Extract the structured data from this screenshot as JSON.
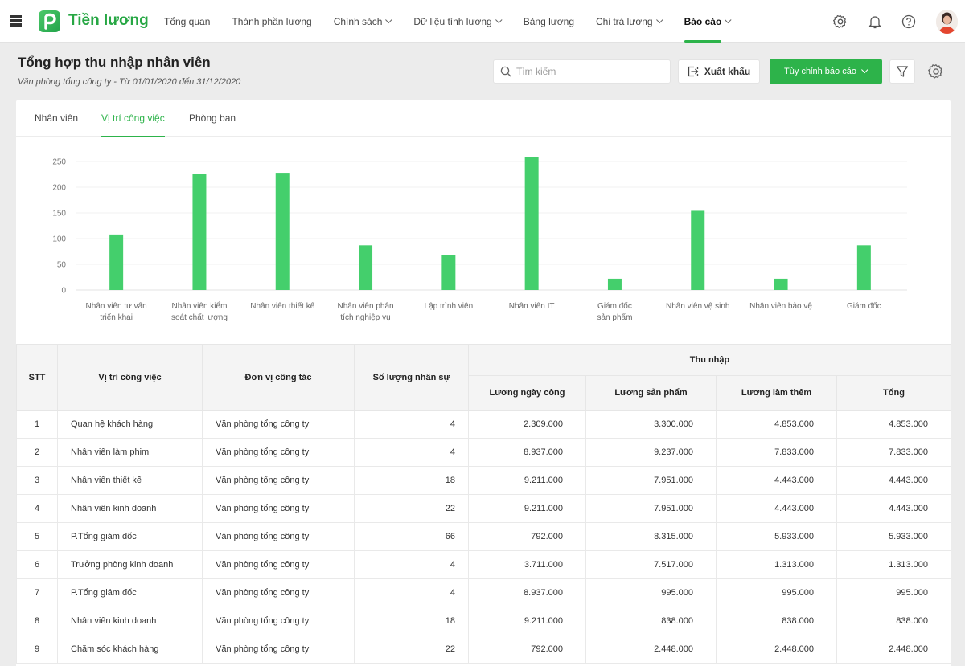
{
  "app": {
    "brand": "Tiền lương",
    "accent_color": "#2db34a",
    "icons": {
      "apps": "grid-icon",
      "settings": "gear-icon",
      "notifications": "bell-icon",
      "help": "help-icon"
    }
  },
  "nav": {
    "items": [
      {
        "label": "Tổng quan",
        "dropdown": false,
        "active": false
      },
      {
        "label": "Thành phần lương",
        "dropdown": false,
        "active": false
      },
      {
        "label": "Chính sách",
        "dropdown": true,
        "active": false
      },
      {
        "label": "Dữ liệu tính lương",
        "dropdown": true,
        "active": false
      },
      {
        "label": "Bảng lương",
        "dropdown": false,
        "active": false
      },
      {
        "label": "Chi trả lương",
        "dropdown": true,
        "active": false
      },
      {
        "label": "Báo cáo",
        "dropdown": true,
        "active": true
      }
    ]
  },
  "header": {
    "title": "Tổng hợp thu nhập nhân viên",
    "subtitle": "Văn phòng tổng công ty - Từ 01/01/2020 đến 31/12/2020",
    "search_placeholder": "Tìm kiếm",
    "export_label": "Xuất khẩu",
    "customize_label": "Tùy chỉnh báo cáo"
  },
  "tabs": [
    {
      "label": "Nhân viên",
      "active": false
    },
    {
      "label": "Vị trí công việc",
      "active": true
    },
    {
      "label": "Phòng ban",
      "active": false
    }
  ],
  "chart_data": {
    "type": "bar",
    "title": "",
    "xlabel": "",
    "ylabel": "",
    "ylim": [
      0,
      250
    ],
    "yticks": [
      0,
      50,
      100,
      150,
      200,
      250
    ],
    "grid": true,
    "color": "#44cf6c",
    "categories": [
      [
        "Nhân viên tư vấn",
        "triển khai"
      ],
      [
        "Nhân viên kiểm",
        "soát chất lượng"
      ],
      [
        "Nhân viên thiết kế"
      ],
      [
        "Nhân viên phân",
        "tích nghiệp vụ"
      ],
      [
        "Lập trình viên"
      ],
      [
        "Nhân viên IT"
      ],
      [
        "Giám đốc",
        "sản phẩm"
      ],
      [
        "Nhân viên vệ sinh"
      ],
      [
        "Nhân viên bảo vệ"
      ],
      [
        "Giám đốc"
      ]
    ],
    "values": [
      108,
      225,
      228,
      87,
      68,
      258,
      22,
      154,
      22,
      87
    ]
  },
  "table": {
    "headers": {
      "stt": "STT",
      "position": "Vị trí công việc",
      "unit": "Đơn vị công tác",
      "headcount": "Số lượng nhân sự",
      "income_group": "Thu nhập",
      "daily": "Lương ngày công",
      "product": "Lương sản phẩm",
      "overtime": "Lương làm thêm",
      "total": "Tổng"
    },
    "rows": [
      {
        "stt": "1",
        "position": "Quan hệ khách hàng",
        "unit": "Văn phòng tổng công ty",
        "headcount": "4",
        "daily": "2.309.000",
        "product": "3.300.000",
        "overtime": "4.853.000",
        "total": "4.853.000"
      },
      {
        "stt": "2",
        "position": "Nhân viên làm phim",
        "unit": "Văn phòng tổng công ty",
        "headcount": "4",
        "daily": "8.937.000",
        "product": "9.237.000",
        "overtime": "7.833.000",
        "total": "7.833.000"
      },
      {
        "stt": "3",
        "position": "Nhân viên thiết kế",
        "unit": "Văn phòng tổng công ty",
        "headcount": "18",
        "daily": "9.211.000",
        "product": "7.951.000",
        "overtime": "4.443.000",
        "total": "4.443.000"
      },
      {
        "stt": "4",
        "position": "Nhân viên kinh doanh",
        "unit": "Văn phòng tổng công ty",
        "headcount": "22",
        "daily": "9.211.000",
        "product": "7.951.000",
        "overtime": "4.443.000",
        "total": "4.443.000"
      },
      {
        "stt": "5",
        "position": "P.Tổng giám đốc",
        "unit": "Văn phòng tổng công ty",
        "headcount": "66",
        "daily": "792.000",
        "product": "8.315.000",
        "overtime": "5.933.000",
        "total": "5.933.000"
      },
      {
        "stt": "6",
        "position": "Trưởng phòng kinh doanh",
        "unit": "Văn phòng tổng công ty",
        "headcount": "4",
        "daily": "3.711.000",
        "product": "7.517.000",
        "overtime": "1.313.000",
        "total": "1.313.000"
      },
      {
        "stt": "7",
        "position": "P.Tổng giám đốc",
        "unit": "Văn phòng tổng công ty",
        "headcount": "4",
        "daily": "8.937.000",
        "product": "995.000",
        "overtime": "995.000",
        "total": "995.000"
      },
      {
        "stt": "8",
        "position": "Nhân viên kinh doanh",
        "unit": "Văn phòng tổng công ty",
        "headcount": "18",
        "daily": "9.211.000",
        "product": "838.000",
        "overtime": "838.000",
        "total": "838.000"
      },
      {
        "stt": "9",
        "position": "Chăm sóc khách hàng",
        "unit": "Văn phòng tổng công ty",
        "headcount": "22",
        "daily": "792.000",
        "product": "2.448.000",
        "overtime": "2.448.000",
        "total": "2.448.000"
      }
    ]
  }
}
